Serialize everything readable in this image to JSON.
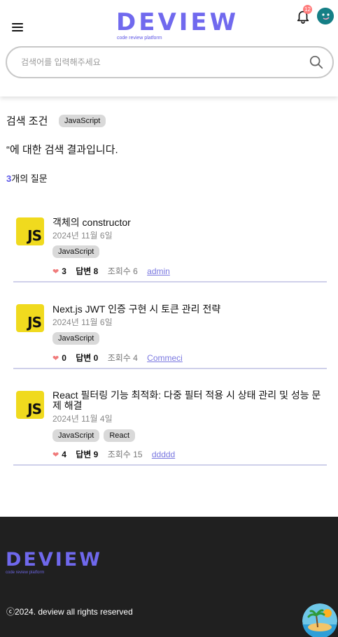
{
  "header": {
    "logo": "DEVIEW",
    "logo_sub": "code review platform",
    "notification_count": "12",
    "search_placeholder": "검색어를 입력해주세요"
  },
  "search_condition": {
    "label": "검색 조건",
    "tag": "JavaScript"
  },
  "result_message": "“에 대한 검색 결과입니다.",
  "question_count": {
    "number": "3",
    "suffix": "개의 질문"
  },
  "questions": [
    {
      "title": "객체의 constructor",
      "date": "2024년 11월 6일",
      "tags": [
        "JavaScript"
      ],
      "likes": "3",
      "answers_label": "답변 8",
      "views": "조회수 6",
      "author": "admin"
    },
    {
      "title": "Next.js JWT 인증 구현 시 토큰 관리 전략",
      "date": "2024년 11월 6일",
      "tags": [
        "JavaScript"
      ],
      "likes": "0",
      "answers_label": "답변 0",
      "views": "조회수 4",
      "author": "Commeci"
    },
    {
      "title": "React 필터링 기능 최적화: 다중 필터 적용 시 상태 관리 및 성능 문제 해결",
      "date": "2024년 11월 4일",
      "tags": [
        "JavaScript",
        "React"
      ],
      "likes": "4",
      "answers_label": "답변 9",
      "views": "조회수 15",
      "author": "ddddd"
    }
  ],
  "icon_label": "JS",
  "footer": {
    "logo": "DEVIEW",
    "logo_sub": "code review platform",
    "copyright": "ⓒ2024. deview all rights reserved"
  },
  "colors": {
    "brand": "#7069ee",
    "js_yellow": "#f0da1e",
    "heart": "#f07a7a",
    "footer_bg": "#202020"
  }
}
